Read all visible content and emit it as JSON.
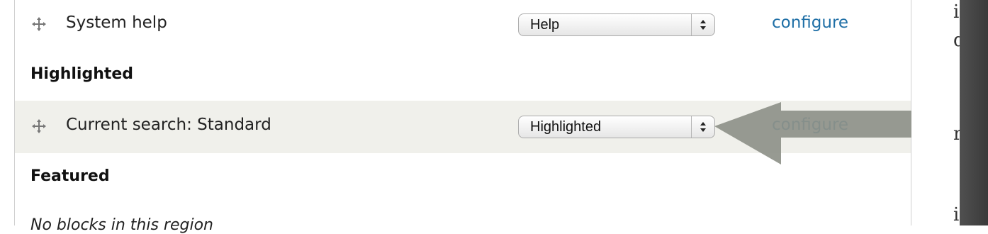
{
  "rows": [
    {
      "type": "block",
      "name": "System help",
      "region": "Help",
      "configure": "configure"
    },
    {
      "type": "region",
      "heading": "Highlighted"
    },
    {
      "type": "block",
      "name": "Current search: Standard",
      "region": "Highlighted",
      "configure": "configure"
    },
    {
      "type": "region",
      "heading": "Featured"
    },
    {
      "type": "empty",
      "message": "No blocks in this region"
    }
  ],
  "book_fragments": [
    "ia st",
    "dule",
    "r or",
    "ich"
  ],
  "colors": {
    "link": "#1f6fa6",
    "highlight_row": "#f0f0eb",
    "arrow": "#8e9189"
  }
}
